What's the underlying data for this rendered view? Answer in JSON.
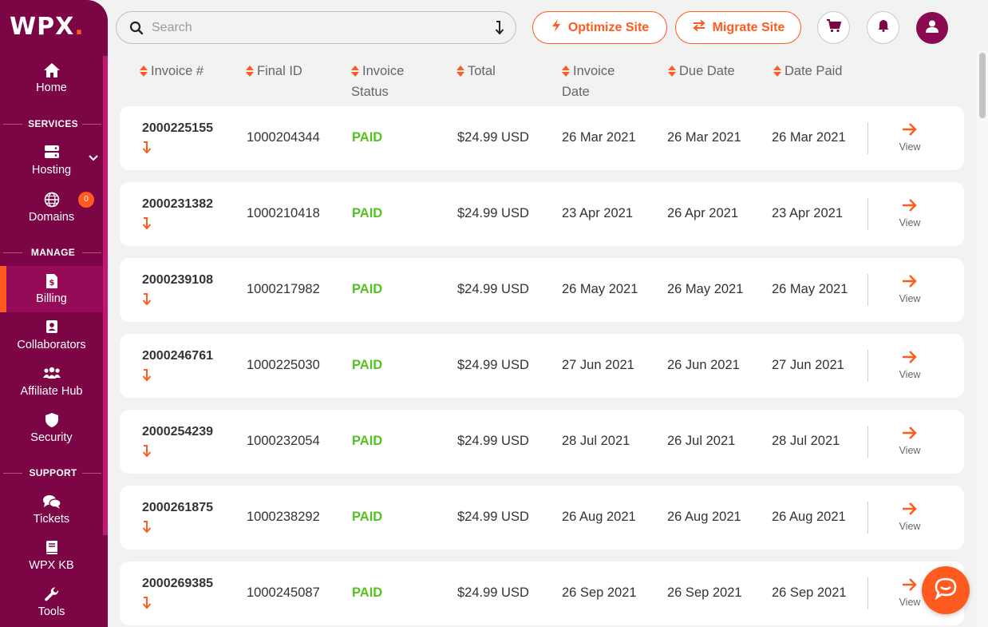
{
  "brand": {
    "logo_text": "WPX",
    "logo_dot": ".",
    "accent": "#ff5a1f",
    "sidebar_bg": "#7c0546",
    "paid_color": "#55c21f"
  },
  "sidebar": {
    "home": "Home",
    "services_label": "SERVICES",
    "hosting": "Hosting",
    "domains": "Domains",
    "domains_badge": "0",
    "manage_label": "MANAGE",
    "billing": "Billing",
    "collaborators": "Collaborators",
    "affiliate": "Affiliate Hub",
    "security": "Security",
    "support_label": "SUPPORT",
    "tickets": "Tickets",
    "kb": "WPX KB",
    "tools": "Tools"
  },
  "topbar": {
    "search_placeholder": "Search",
    "optimize": "Optimize Site",
    "migrate": "Migrate Site"
  },
  "table": {
    "headers": {
      "invoice": "Invoice #",
      "final_id": "Final ID",
      "status_1": "Invoice",
      "status_2": "Status",
      "total": "Total",
      "inv_date_1": "Invoice",
      "inv_date_2": "Date",
      "due_date": "Due Date",
      "date_paid": "Date Paid"
    },
    "view_label": "View",
    "rows": [
      {
        "invoice": "2000225155",
        "final_id": "1000204344",
        "status": "PAID",
        "total": "$24.99 USD",
        "invoice_date": "26 Mar 2021",
        "due_date": "26 Mar 2021",
        "date_paid": "26 Mar 2021"
      },
      {
        "invoice": "2000231382",
        "final_id": "1000210418",
        "status": "PAID",
        "total": "$24.99 USD",
        "invoice_date": "23 Apr 2021",
        "due_date": "26 Apr 2021",
        "date_paid": "23 Apr 2021"
      },
      {
        "invoice": "2000239108",
        "final_id": "1000217982",
        "status": "PAID",
        "total": "$24.99 USD",
        "invoice_date": "26 May 2021",
        "due_date": "26 May 2021",
        "date_paid": "26 May 2021"
      },
      {
        "invoice": "2000246761",
        "final_id": "1000225030",
        "status": "PAID",
        "total": "$24.99 USD",
        "invoice_date": "27 Jun 2021",
        "due_date": "26 Jun 2021",
        "date_paid": "27 Jun 2021"
      },
      {
        "invoice": "2000254239",
        "final_id": "1000232054",
        "status": "PAID",
        "total": "$24.99 USD",
        "invoice_date": "28 Jul 2021",
        "due_date": "26 Jul 2021",
        "date_paid": "28 Jul 2021"
      },
      {
        "invoice": "2000261875",
        "final_id": "1000238292",
        "status": "PAID",
        "total": "$24.99 USD",
        "invoice_date": "26 Aug 2021",
        "due_date": "26 Aug 2021",
        "date_paid": "26 Aug 2021"
      },
      {
        "invoice": "2000269385",
        "final_id": "1000245087",
        "status": "PAID",
        "total": "$24.99 USD",
        "invoice_date": "26 Sep 2021",
        "due_date": "26 Sep 2021",
        "date_paid": "26 Sep 2021"
      }
    ]
  }
}
